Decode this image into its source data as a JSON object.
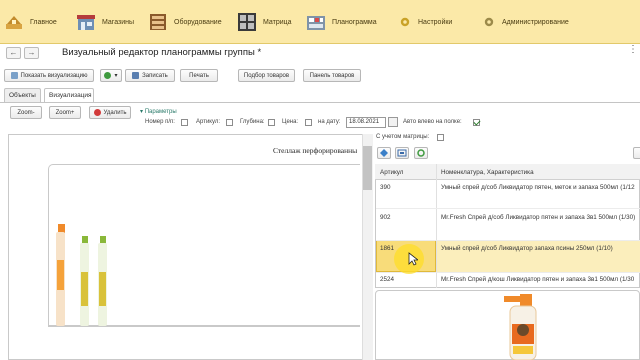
{
  "sections": [
    {
      "label": "Главное",
      "icon": "home-icon"
    },
    {
      "label": "Магазины",
      "icon": "store-icon"
    },
    {
      "label": "Оборудование",
      "icon": "shelving-icon"
    },
    {
      "label": "Матрица",
      "icon": "matrix-icon"
    },
    {
      "label": "Планограмма",
      "icon": "planogram-icon"
    },
    {
      "label": "Настройки",
      "icon": "settings-icon"
    },
    {
      "label": "Администрирование",
      "icon": "admin-icon"
    }
  ],
  "window": {
    "title": "Визуальный редактор планограммы группы *",
    "back_glyph": "←",
    "forward_glyph": "→",
    "more_glyph": "⋮"
  },
  "toolbar": {
    "show_viz": "Показать визуализацию",
    "refresh": "▾",
    "write": "Записать",
    "print": "Печать",
    "pick_goods": "Подбор товаров",
    "goods_panel": "Панель товаров"
  },
  "tabs": [
    "Объекты",
    "Визуализация"
  ],
  "params": {
    "zoom_minus": "Zoom-",
    "zoom_plus": "Zoom+",
    "delete": "Удалить",
    "params_toggle": "Параметры",
    "num_label": "Номер п/п:",
    "article_label": "Артикул:",
    "depth_label": "Глубина:",
    "price_label": "Цена:",
    "date_label": "на дату:",
    "date_value": "18.08.2021",
    "auto_label": "Авто влево на полке:",
    "matrix_label": "С учетом матрицы:"
  },
  "canvas": {
    "shelf_title": "Стеллаж перфорированны"
  },
  "grid": {
    "col_article": "Артикул",
    "col_name": "Номенклатура, Характеристика",
    "rows": [
      {
        "article": "390",
        "name": "Умный спрей д/соб Ликвидатор пятен, меток и запаха 500мл (1/12"
      },
      {
        "article": "902",
        "name": "Mr.Fresh Спрей д/соб Ликвидатор пятен и запаха 3в1 500мл (1/30)"
      },
      {
        "article": "1861",
        "name": "Умный спрей д/соб Ликвидатор запаха псины 250мл (1/10)"
      },
      {
        "article": "2524",
        "name": "Mr.Fresh Спрей д/кош Ликвидатор пятен и запаха 3в1 500мл (1/30"
      }
    ]
  },
  "colors": {
    "topbar": "#fbe9a8",
    "selection": "#fbeebc",
    "accent_green": "#2a7a2a"
  }
}
